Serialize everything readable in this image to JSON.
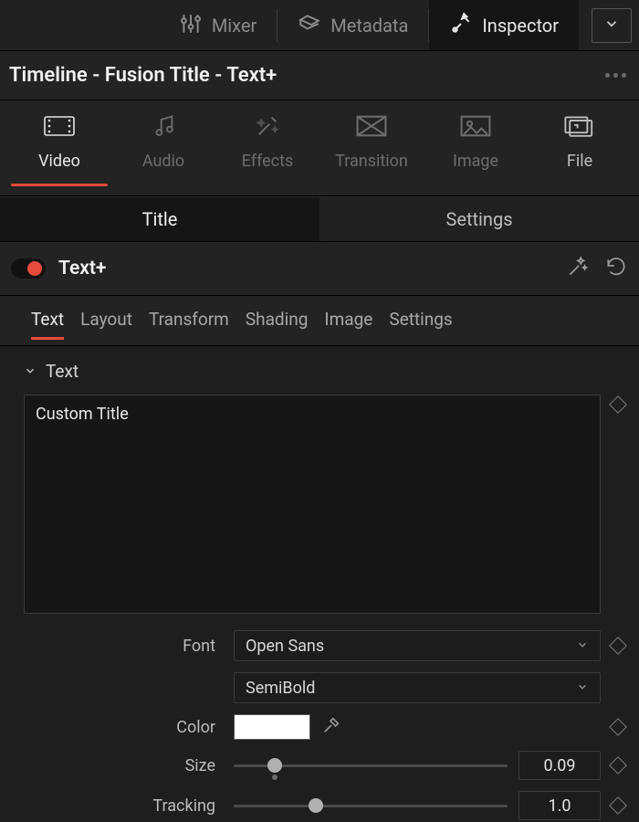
{
  "topbar": {
    "mixer": "Mixer",
    "metadata": "Metadata",
    "inspector": "Inspector"
  },
  "clip_title": "Timeline - Fusion Title - Text+",
  "categories": {
    "video": "Video",
    "audio": "Audio",
    "effects": "Effects",
    "transition": "Transition",
    "image": "Image",
    "file": "File"
  },
  "ts": {
    "title": "Title",
    "settings": "Settings"
  },
  "effect": {
    "name": "Text+"
  },
  "subtabs": {
    "text": "Text",
    "layout": "Layout",
    "transform": "Transform",
    "shading": "Shading",
    "image": "Image",
    "settings": "Settings"
  },
  "section_text": "Text",
  "props": {
    "text_value": "Custom Title",
    "font_label": "Font",
    "font_family": "Open Sans",
    "font_weight": "SemiBold",
    "color_label": "Color",
    "color_value": "#ffffff",
    "size_label": "Size",
    "size_value": "0.09",
    "size_pos_pct": 15,
    "tracking_label": "Tracking",
    "tracking_value": "1.0",
    "tracking_pos_pct": 30
  }
}
